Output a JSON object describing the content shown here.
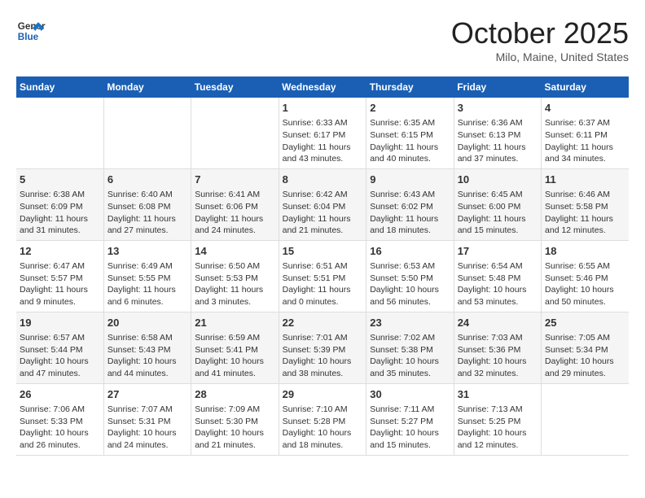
{
  "header": {
    "logo_line1": "General",
    "logo_line2": "Blue",
    "month": "October 2025",
    "location": "Milo, Maine, United States"
  },
  "days_of_week": [
    "Sunday",
    "Monday",
    "Tuesday",
    "Wednesday",
    "Thursday",
    "Friday",
    "Saturday"
  ],
  "weeks": [
    [
      {
        "day": "",
        "text": ""
      },
      {
        "day": "",
        "text": ""
      },
      {
        "day": "",
        "text": ""
      },
      {
        "day": "1",
        "text": "Sunrise: 6:33 AM\nSunset: 6:17 PM\nDaylight: 11 hours and 43 minutes."
      },
      {
        "day": "2",
        "text": "Sunrise: 6:35 AM\nSunset: 6:15 PM\nDaylight: 11 hours and 40 minutes."
      },
      {
        "day": "3",
        "text": "Sunrise: 6:36 AM\nSunset: 6:13 PM\nDaylight: 11 hours and 37 minutes."
      },
      {
        "day": "4",
        "text": "Sunrise: 6:37 AM\nSunset: 6:11 PM\nDaylight: 11 hours and 34 minutes."
      }
    ],
    [
      {
        "day": "5",
        "text": "Sunrise: 6:38 AM\nSunset: 6:09 PM\nDaylight: 11 hours and 31 minutes."
      },
      {
        "day": "6",
        "text": "Sunrise: 6:40 AM\nSunset: 6:08 PM\nDaylight: 11 hours and 27 minutes."
      },
      {
        "day": "7",
        "text": "Sunrise: 6:41 AM\nSunset: 6:06 PM\nDaylight: 11 hours and 24 minutes."
      },
      {
        "day": "8",
        "text": "Sunrise: 6:42 AM\nSunset: 6:04 PM\nDaylight: 11 hours and 21 minutes."
      },
      {
        "day": "9",
        "text": "Sunrise: 6:43 AM\nSunset: 6:02 PM\nDaylight: 11 hours and 18 minutes."
      },
      {
        "day": "10",
        "text": "Sunrise: 6:45 AM\nSunset: 6:00 PM\nDaylight: 11 hours and 15 minutes."
      },
      {
        "day": "11",
        "text": "Sunrise: 6:46 AM\nSunset: 5:58 PM\nDaylight: 11 hours and 12 minutes."
      }
    ],
    [
      {
        "day": "12",
        "text": "Sunrise: 6:47 AM\nSunset: 5:57 PM\nDaylight: 11 hours and 9 minutes."
      },
      {
        "day": "13",
        "text": "Sunrise: 6:49 AM\nSunset: 5:55 PM\nDaylight: 11 hours and 6 minutes."
      },
      {
        "day": "14",
        "text": "Sunrise: 6:50 AM\nSunset: 5:53 PM\nDaylight: 11 hours and 3 minutes."
      },
      {
        "day": "15",
        "text": "Sunrise: 6:51 AM\nSunset: 5:51 PM\nDaylight: 11 hours and 0 minutes."
      },
      {
        "day": "16",
        "text": "Sunrise: 6:53 AM\nSunset: 5:50 PM\nDaylight: 10 hours and 56 minutes."
      },
      {
        "day": "17",
        "text": "Sunrise: 6:54 AM\nSunset: 5:48 PM\nDaylight: 10 hours and 53 minutes."
      },
      {
        "day": "18",
        "text": "Sunrise: 6:55 AM\nSunset: 5:46 PM\nDaylight: 10 hours and 50 minutes."
      }
    ],
    [
      {
        "day": "19",
        "text": "Sunrise: 6:57 AM\nSunset: 5:44 PM\nDaylight: 10 hours and 47 minutes."
      },
      {
        "day": "20",
        "text": "Sunrise: 6:58 AM\nSunset: 5:43 PM\nDaylight: 10 hours and 44 minutes."
      },
      {
        "day": "21",
        "text": "Sunrise: 6:59 AM\nSunset: 5:41 PM\nDaylight: 10 hours and 41 minutes."
      },
      {
        "day": "22",
        "text": "Sunrise: 7:01 AM\nSunset: 5:39 PM\nDaylight: 10 hours and 38 minutes."
      },
      {
        "day": "23",
        "text": "Sunrise: 7:02 AM\nSunset: 5:38 PM\nDaylight: 10 hours and 35 minutes."
      },
      {
        "day": "24",
        "text": "Sunrise: 7:03 AM\nSunset: 5:36 PM\nDaylight: 10 hours and 32 minutes."
      },
      {
        "day": "25",
        "text": "Sunrise: 7:05 AM\nSunset: 5:34 PM\nDaylight: 10 hours and 29 minutes."
      }
    ],
    [
      {
        "day": "26",
        "text": "Sunrise: 7:06 AM\nSunset: 5:33 PM\nDaylight: 10 hours and 26 minutes."
      },
      {
        "day": "27",
        "text": "Sunrise: 7:07 AM\nSunset: 5:31 PM\nDaylight: 10 hours and 24 minutes."
      },
      {
        "day": "28",
        "text": "Sunrise: 7:09 AM\nSunset: 5:30 PM\nDaylight: 10 hours and 21 minutes."
      },
      {
        "day": "29",
        "text": "Sunrise: 7:10 AM\nSunset: 5:28 PM\nDaylight: 10 hours and 18 minutes."
      },
      {
        "day": "30",
        "text": "Sunrise: 7:11 AM\nSunset: 5:27 PM\nDaylight: 10 hours and 15 minutes."
      },
      {
        "day": "31",
        "text": "Sunrise: 7:13 AM\nSunset: 5:25 PM\nDaylight: 10 hours and 12 minutes."
      },
      {
        "day": "",
        "text": ""
      }
    ]
  ]
}
